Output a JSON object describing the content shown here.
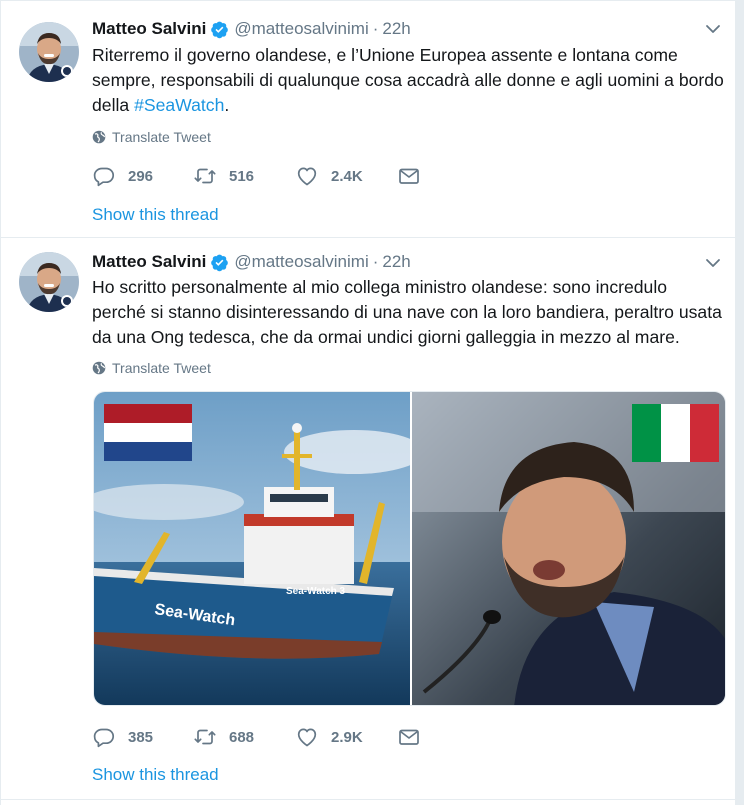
{
  "tweets": [
    {
      "author_name": "Matteo Salvini",
      "handle": "@matteosalvinimi",
      "separator": "·",
      "time": "22h",
      "text_before_hashtag": "Riterremo il governo olandese, e l’Unione Europea assente e lontana come sempre, responsabili di qualunque cosa accadrà alle donne e agli uomini a bordo della ",
      "hashtag": "#SeaWatch",
      "text_after_hashtag": ".",
      "translate_label": "Translate Tweet",
      "replies": "296",
      "retweets": "516",
      "likes": "2.4K",
      "thread_link": "Show this thread"
    },
    {
      "author_name": "Matteo Salvini",
      "handle": "@matteosalvinimi",
      "separator": "·",
      "time": "22h",
      "text": "Ho scritto personalmente al mio collega ministro olandese: sono incredulo perché si stanno disinteressando di una nave con la loro bandiera, peraltro usata da una Ong tedesca, che da ormai undici giorni galleggia in mezzo al mare.",
      "translate_label": "Translate Tweet",
      "media": {
        "ship_hull_text": "Sea-Watch",
        "ship_bridge_text": "Sea-Watch 3"
      },
      "replies": "385",
      "retweets": "688",
      "likes": "2.9K",
      "thread_link": "Show this thread"
    }
  ],
  "colors": {
    "link_blue": "#1b95e0",
    "secondary_text": "#657786",
    "verified_blue": "#1da1f2",
    "divider": "#e6ecf0"
  },
  "icons": [
    "verified-badge-icon",
    "chevron-down-icon",
    "globe-icon",
    "reply-icon",
    "retweet-icon",
    "like-icon",
    "direct-message-icon"
  ]
}
